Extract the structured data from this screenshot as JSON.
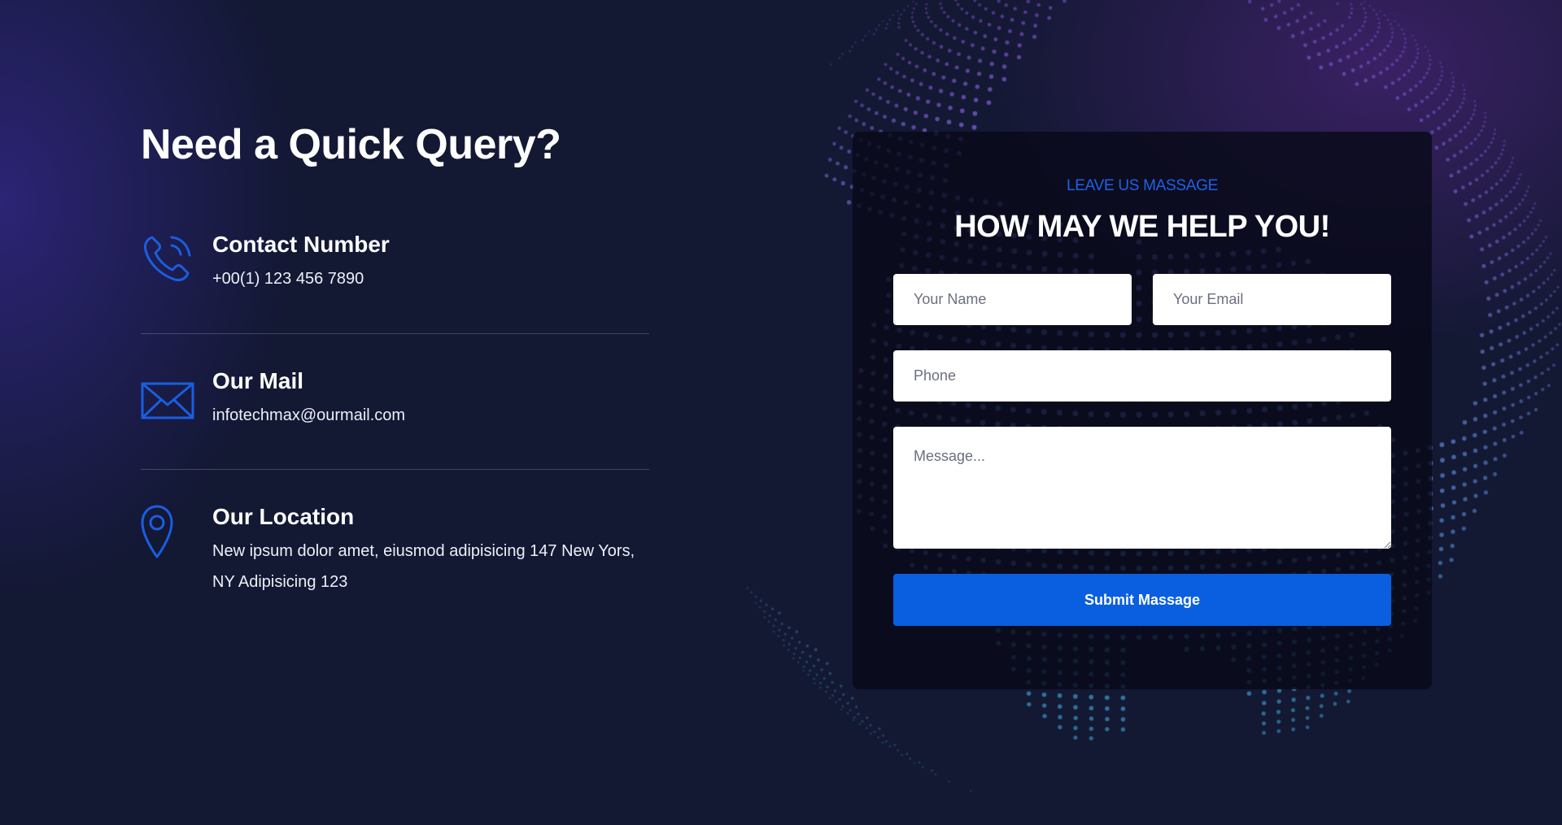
{
  "section": {
    "title": "Need a Quick Query?"
  },
  "contacts": [
    {
      "icon": "phone-icon",
      "title": "Contact Number",
      "value": "+00(1) 123 456 7890"
    },
    {
      "icon": "mail-icon",
      "title": "Our Mail",
      "value": "infotechmax@ourmail.com"
    },
    {
      "icon": "location-pin-icon",
      "title": "Our Location",
      "value": "New ipsum dolor amet, eiusmod adipisicing 147 New Yors, NY Adipisicing 123"
    }
  ],
  "form": {
    "eyebrow": "LEAVE US MASSAGE",
    "heading": "HOW MAY WE HELP YOU!",
    "name_placeholder": "Your Name",
    "email_placeholder": "Your Email",
    "phone_placeholder": "Phone",
    "message_placeholder": "Message...",
    "submit_label": "Submit Massage"
  },
  "colors": {
    "background": "#131833",
    "accent": "#0a5fe0",
    "eyebrow": "#1f62e6",
    "icon": "#1a5ee0"
  }
}
